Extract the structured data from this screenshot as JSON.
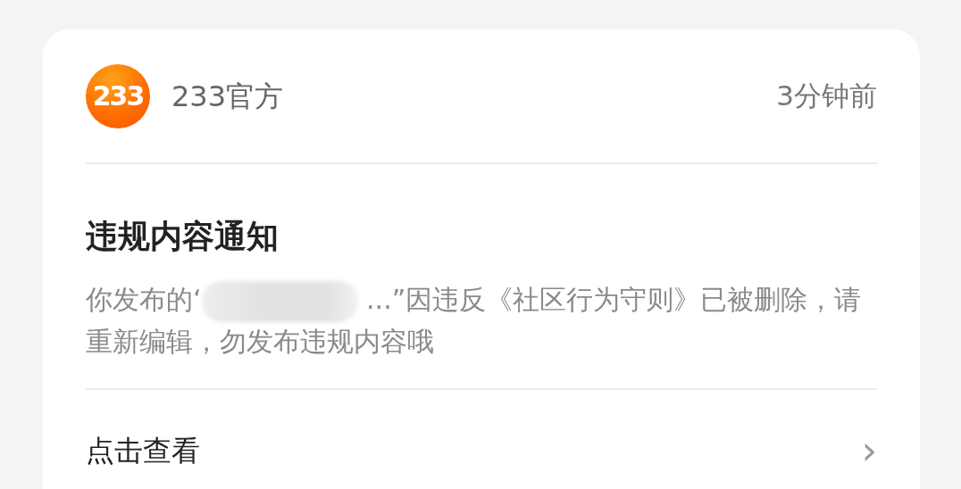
{
  "sender": {
    "logo_text": "233",
    "name": "233官方",
    "time": "3分钟前"
  },
  "notice": {
    "title": "违规内容通知",
    "message_before": "你发布的‘",
    "redacted": true,
    "message_after": " ...”因违反《社区行为守则》已被删除，请重新编辑，勿发布违规内容哦"
  },
  "action": {
    "label": "点击查看",
    "icon": "›"
  }
}
